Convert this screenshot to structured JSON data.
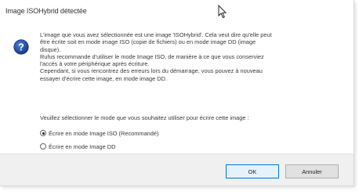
{
  "dialog": {
    "title": "Image ISOHybrid détectée",
    "icon": "question-icon",
    "message": [
      "L'image que vous avez sélectionnée est une image 'ISOHybrid'. Cela veut dire qu'elle peut",
      "être écrite soit en mode image ISO (copie de fichiers) ou en mode image DD (image",
      "disque).",
      "Rufus recommande d'utiliser le mode Image ISO, de manière à ce que vous conserviez",
      "l'accès à votre périphérique après écriture.",
      "Cependant, si vous rencontrez des erreurs lors du démarrage, vous pouvez à nouveau",
      "essayer d'écrire cette image, en mode image DD."
    ],
    "prompt": "Veuillez sélectionner le mode que vous souhaitez utiliser pour écrire cette image :",
    "options": [
      {
        "label": "Écrire en mode Image ISO (Recommandé)",
        "checked": true
      },
      {
        "label": "Écrire en mode Image DD",
        "checked": false
      }
    ],
    "ok_label": "OK",
    "cancel_label": "Annuler"
  },
  "colors": {
    "icon_blue": "#1f4fa3",
    "footer_bg": "#f0f0f0",
    "ok_border": "#0078d7"
  }
}
